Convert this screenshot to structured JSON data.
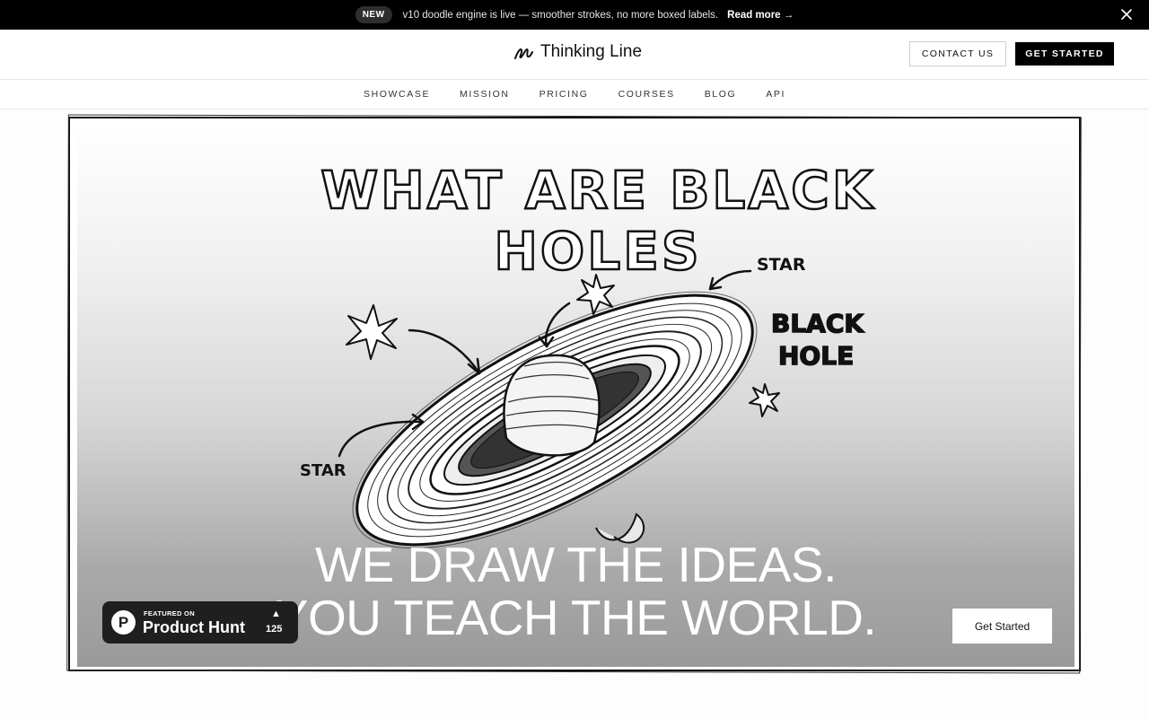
{
  "announcement": {
    "badge": "NEW",
    "message": "v10 doodle engine is live — smoother strokes, no more boxed labels.",
    "link_label": "Read more →",
    "close_icon": "close-icon"
  },
  "header": {
    "brand_name": "Thinking Line",
    "logo_icon": "scribble-logo-icon",
    "contact_label": "CONTACT US",
    "get_started_label": "GET STARTED"
  },
  "nav": {
    "items": [
      {
        "label": "SHOWCASE"
      },
      {
        "label": "MISSION"
      },
      {
        "label": "PRICING"
      },
      {
        "label": "COURSES"
      },
      {
        "label": "BLOG"
      },
      {
        "label": "API"
      }
    ]
  },
  "hero": {
    "doodle_title": "WHAT ARE BLACK HOLES",
    "labels": {
      "star_top": "STAR",
      "star_left": "STAR",
      "black_hole_line1": "BLACK",
      "black_hole_line2": "HOLE"
    },
    "tagline_line1": "WE DRAW THE IDEAS.",
    "tagline_line2": "YOU TEACH THE WORLD.",
    "cta_label": "Get Started"
  },
  "product_hunt": {
    "featured_text": "FEATURED ON",
    "name": "Product Hunt",
    "logo_letter": "P",
    "upvote_icon": "▲",
    "votes": "125"
  },
  "colors": {
    "announcement_bg": "#000000",
    "primary_button": "#000000",
    "badge_bg": "#1f1f1f"
  }
}
